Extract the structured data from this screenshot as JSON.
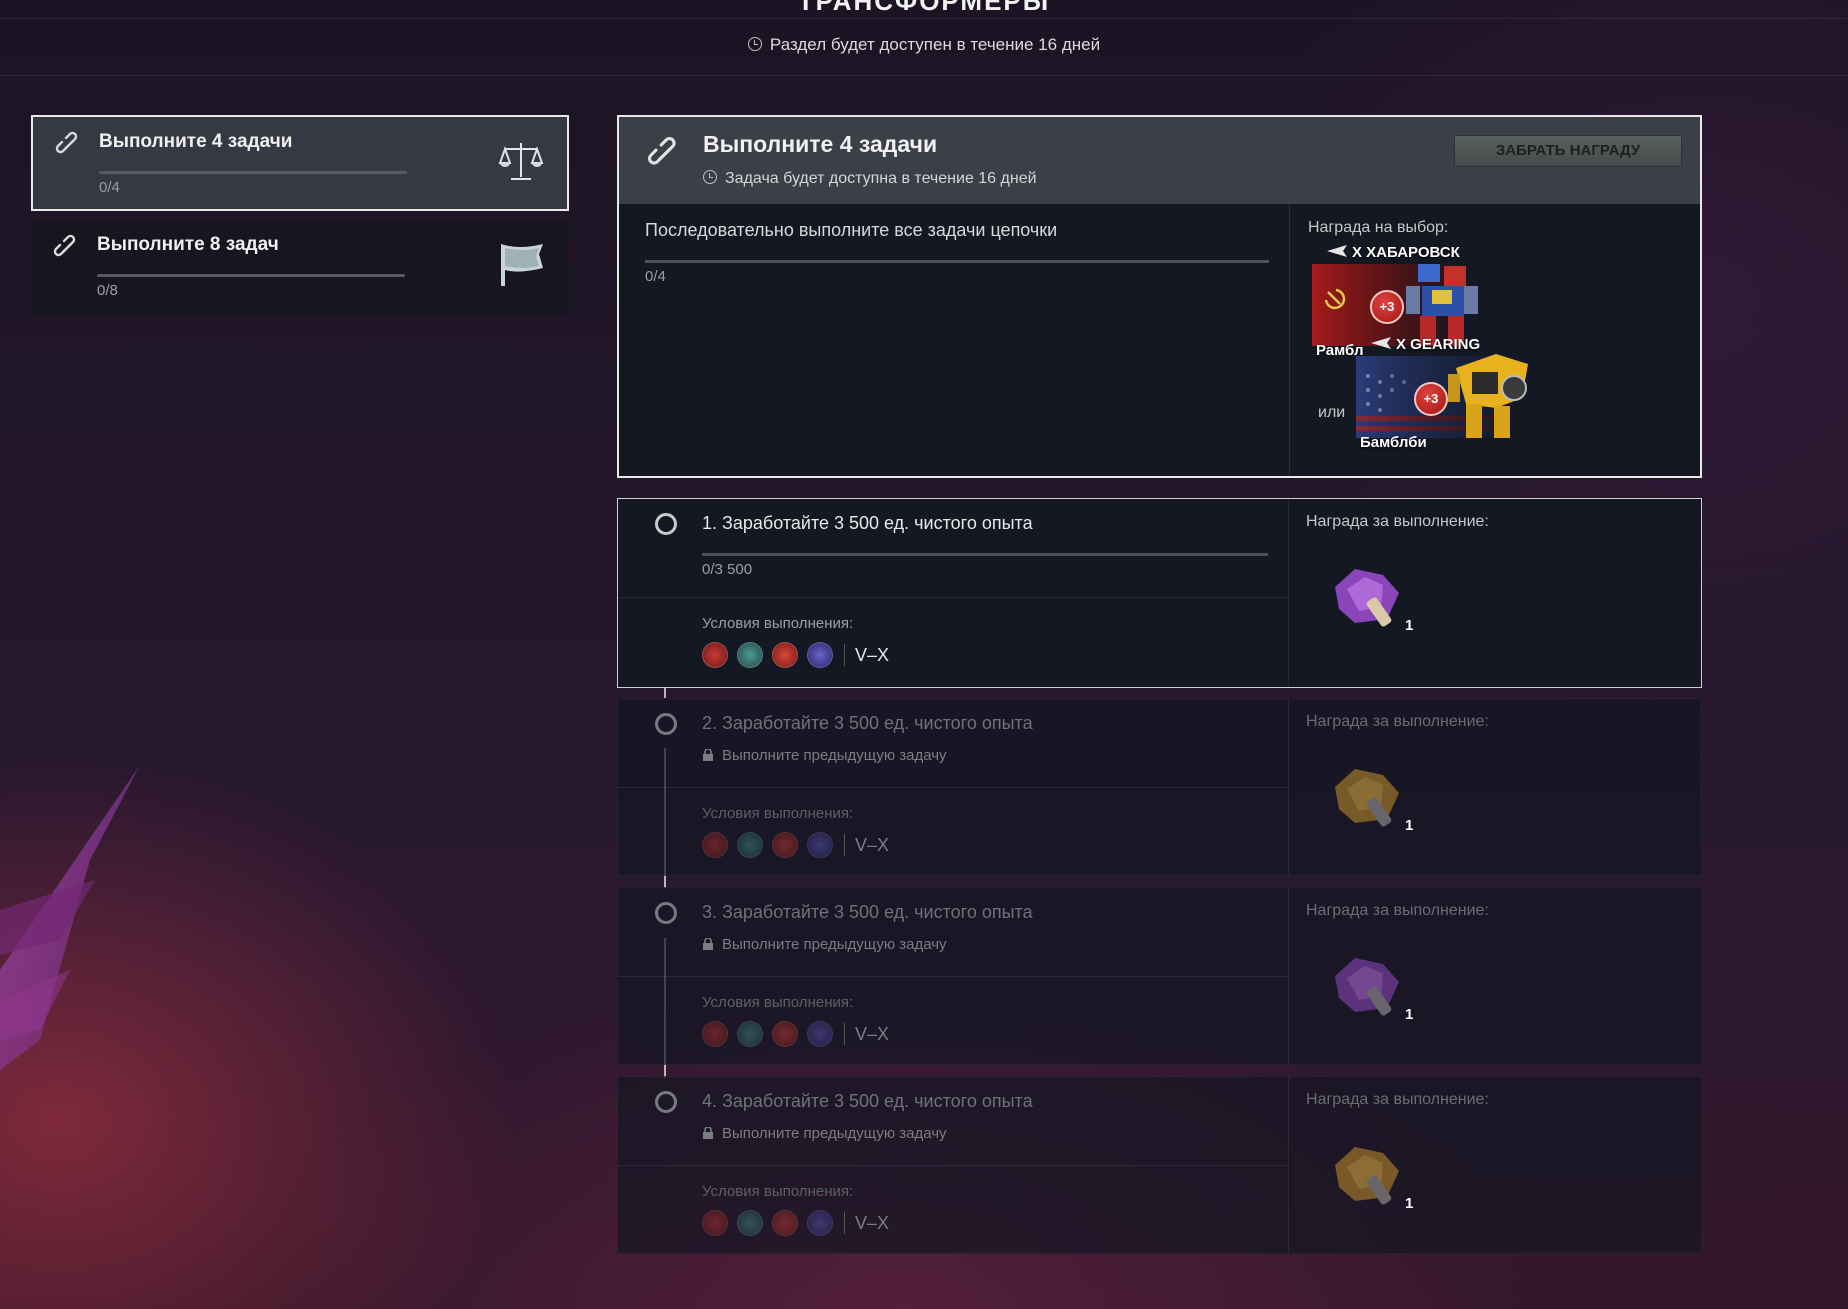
{
  "header": {
    "title": "ТРАНСФОРМЕРЫ",
    "timer": "Раздел будет доступен в течение 16 дней"
  },
  "quest_list": [
    {
      "title": "Выполните 4 задачи",
      "progress": "0/4",
      "icon": "scales-icon"
    },
    {
      "title": "Выполните 8 задач",
      "progress": "0/8",
      "icon": "flag-icon"
    }
  ],
  "main": {
    "title": "Выполните 4 задачи",
    "subtitle": "Задача будет доступна в течение 16 дней",
    "claim_button": "ЗАБРАТЬ НАГРАДУ",
    "description": "Последовательно выполните все задачи цепочки",
    "progress": "0/4",
    "reward_label": "Награда на выбор:",
    "or_label": "или",
    "rewards": [
      {
        "tank": "X ХАБАРОВСК",
        "character": "Рамбл",
        "badge": "+3",
        "nation_color": "#b31e1e"
      },
      {
        "tank": "X GEARING",
        "character": "Бамблби",
        "badge": "+3",
        "nation_color": "#2b3c78"
      }
    ]
  },
  "tasks": [
    {
      "title": "1. Заработайте 3 500 ед. чистого опыта",
      "progress": "0/3 500",
      "locked": false,
      "lock_text": "",
      "cond_label": "Условия выполнения:",
      "tiers": "V–X",
      "reward_label": "Награда за выполнение:",
      "reward_count": "1",
      "reward_color": "purple"
    },
    {
      "title": "2. Заработайте 3 500 ед. чистого опыта",
      "progress": "",
      "locked": true,
      "lock_text": "Выполните предыдущую задачу",
      "cond_label": "Условия выполнения:",
      "tiers": "V–X",
      "reward_label": "Награда за выполнение:",
      "reward_count": "1",
      "reward_color": "gold"
    },
    {
      "title": "3. Заработайте 3 500 ед. чистого опыта",
      "progress": "",
      "locked": true,
      "lock_text": "Выполните предыдущую задачу",
      "cond_label": "Условия выполнения:",
      "tiers": "V–X",
      "reward_label": "Награда за выполнение:",
      "reward_count": "1",
      "reward_color": "purple"
    },
    {
      "title": "4. Заработайте 3 500 ед. чистого опыта",
      "progress": "",
      "locked": true,
      "lock_text": "Выполните предыдущую задачу",
      "cond_label": "Условия выполнения:",
      "tiers": "V–X",
      "reward_label": "Награда за выполнение:",
      "reward_count": "1",
      "reward_color": "gold"
    }
  ],
  "nations": [
    "ussr-icon",
    "germany-icon",
    "china-icon",
    "usa-icon"
  ]
}
